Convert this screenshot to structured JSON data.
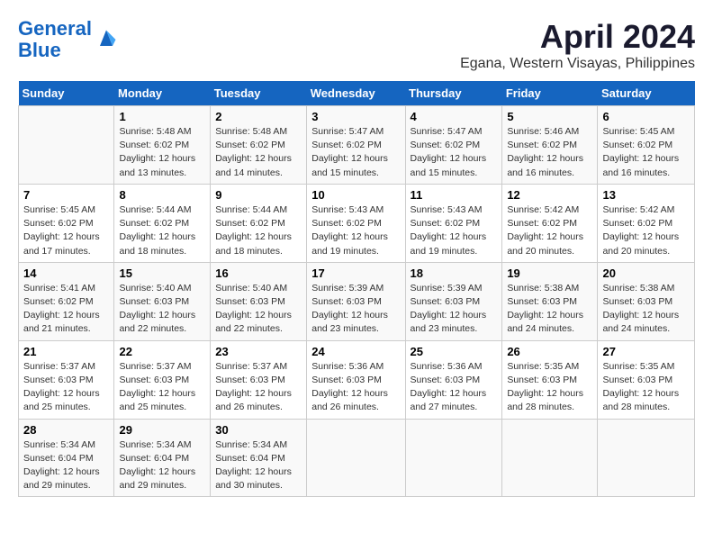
{
  "header": {
    "logo_line1": "General",
    "logo_line2": "Blue",
    "month": "April 2024",
    "location": "Egana, Western Visayas, Philippines"
  },
  "weekdays": [
    "Sunday",
    "Monday",
    "Tuesday",
    "Wednesday",
    "Thursday",
    "Friday",
    "Saturday"
  ],
  "weeks": [
    [
      {
        "day": "",
        "info": ""
      },
      {
        "day": "1",
        "info": "Sunrise: 5:48 AM\nSunset: 6:02 PM\nDaylight: 12 hours\nand 13 minutes."
      },
      {
        "day": "2",
        "info": "Sunrise: 5:48 AM\nSunset: 6:02 PM\nDaylight: 12 hours\nand 14 minutes."
      },
      {
        "day": "3",
        "info": "Sunrise: 5:47 AM\nSunset: 6:02 PM\nDaylight: 12 hours\nand 15 minutes."
      },
      {
        "day": "4",
        "info": "Sunrise: 5:47 AM\nSunset: 6:02 PM\nDaylight: 12 hours\nand 15 minutes."
      },
      {
        "day": "5",
        "info": "Sunrise: 5:46 AM\nSunset: 6:02 PM\nDaylight: 12 hours\nand 16 minutes."
      },
      {
        "day": "6",
        "info": "Sunrise: 5:45 AM\nSunset: 6:02 PM\nDaylight: 12 hours\nand 16 minutes."
      }
    ],
    [
      {
        "day": "7",
        "info": "Sunrise: 5:45 AM\nSunset: 6:02 PM\nDaylight: 12 hours\nand 17 minutes."
      },
      {
        "day": "8",
        "info": "Sunrise: 5:44 AM\nSunset: 6:02 PM\nDaylight: 12 hours\nand 18 minutes."
      },
      {
        "day": "9",
        "info": "Sunrise: 5:44 AM\nSunset: 6:02 PM\nDaylight: 12 hours\nand 18 minutes."
      },
      {
        "day": "10",
        "info": "Sunrise: 5:43 AM\nSunset: 6:02 PM\nDaylight: 12 hours\nand 19 minutes."
      },
      {
        "day": "11",
        "info": "Sunrise: 5:43 AM\nSunset: 6:02 PM\nDaylight: 12 hours\nand 19 minutes."
      },
      {
        "day": "12",
        "info": "Sunrise: 5:42 AM\nSunset: 6:02 PM\nDaylight: 12 hours\nand 20 minutes."
      },
      {
        "day": "13",
        "info": "Sunrise: 5:42 AM\nSunset: 6:02 PM\nDaylight: 12 hours\nand 20 minutes."
      }
    ],
    [
      {
        "day": "14",
        "info": "Sunrise: 5:41 AM\nSunset: 6:02 PM\nDaylight: 12 hours\nand 21 minutes."
      },
      {
        "day": "15",
        "info": "Sunrise: 5:40 AM\nSunset: 6:03 PM\nDaylight: 12 hours\nand 22 minutes."
      },
      {
        "day": "16",
        "info": "Sunrise: 5:40 AM\nSunset: 6:03 PM\nDaylight: 12 hours\nand 22 minutes."
      },
      {
        "day": "17",
        "info": "Sunrise: 5:39 AM\nSunset: 6:03 PM\nDaylight: 12 hours\nand 23 minutes."
      },
      {
        "day": "18",
        "info": "Sunrise: 5:39 AM\nSunset: 6:03 PM\nDaylight: 12 hours\nand 23 minutes."
      },
      {
        "day": "19",
        "info": "Sunrise: 5:38 AM\nSunset: 6:03 PM\nDaylight: 12 hours\nand 24 minutes."
      },
      {
        "day": "20",
        "info": "Sunrise: 5:38 AM\nSunset: 6:03 PM\nDaylight: 12 hours\nand 24 minutes."
      }
    ],
    [
      {
        "day": "21",
        "info": "Sunrise: 5:37 AM\nSunset: 6:03 PM\nDaylight: 12 hours\nand 25 minutes."
      },
      {
        "day": "22",
        "info": "Sunrise: 5:37 AM\nSunset: 6:03 PM\nDaylight: 12 hours\nand 25 minutes."
      },
      {
        "day": "23",
        "info": "Sunrise: 5:37 AM\nSunset: 6:03 PM\nDaylight: 12 hours\nand 26 minutes."
      },
      {
        "day": "24",
        "info": "Sunrise: 5:36 AM\nSunset: 6:03 PM\nDaylight: 12 hours\nand 26 minutes."
      },
      {
        "day": "25",
        "info": "Sunrise: 5:36 AM\nSunset: 6:03 PM\nDaylight: 12 hours\nand 27 minutes."
      },
      {
        "day": "26",
        "info": "Sunrise: 5:35 AM\nSunset: 6:03 PM\nDaylight: 12 hours\nand 28 minutes."
      },
      {
        "day": "27",
        "info": "Sunrise: 5:35 AM\nSunset: 6:03 PM\nDaylight: 12 hours\nand 28 minutes."
      }
    ],
    [
      {
        "day": "28",
        "info": "Sunrise: 5:34 AM\nSunset: 6:04 PM\nDaylight: 12 hours\nand 29 minutes."
      },
      {
        "day": "29",
        "info": "Sunrise: 5:34 AM\nSunset: 6:04 PM\nDaylight: 12 hours\nand 29 minutes."
      },
      {
        "day": "30",
        "info": "Sunrise: 5:34 AM\nSunset: 6:04 PM\nDaylight: 12 hours\nand 30 minutes."
      },
      {
        "day": "",
        "info": ""
      },
      {
        "day": "",
        "info": ""
      },
      {
        "day": "",
        "info": ""
      },
      {
        "day": "",
        "info": ""
      }
    ]
  ]
}
